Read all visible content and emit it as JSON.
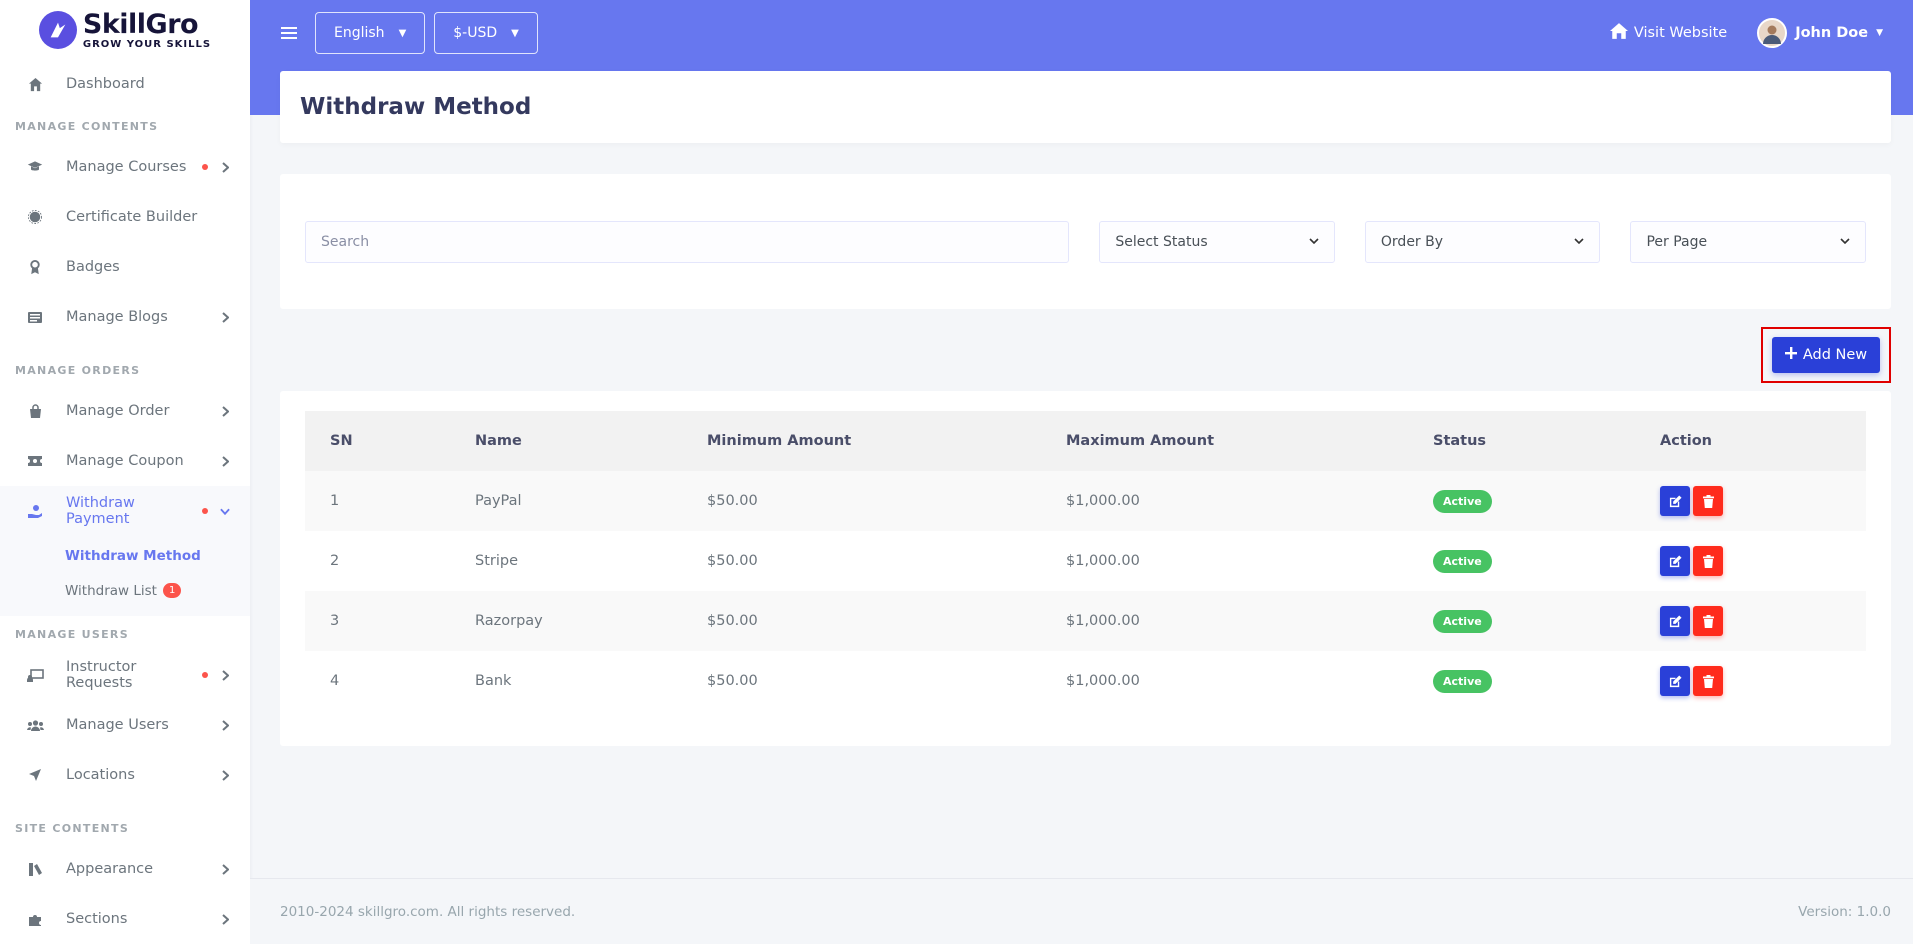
{
  "brand": {
    "name": "SkillGro",
    "tagline": "GROW YOUR SKILLS"
  },
  "sidebar": {
    "dashboard": "Dashboard",
    "headers": [
      "MANAGE CONTENTS",
      "MANAGE ORDERS",
      "MANAGE USERS",
      "SITE CONTENTS"
    ],
    "items": {
      "manage_courses": "Manage Courses",
      "certificate_builder": "Certificate Builder",
      "badges": "Badges",
      "manage_blogs": "Manage Blogs",
      "manage_order": "Manage Order",
      "manage_coupon": "Manage Coupon",
      "withdraw_payment": "Withdraw Payment",
      "instructor_requests": "Instructor Requests",
      "manage_users": "Manage Users",
      "locations": "Locations",
      "appearance": "Appearance",
      "sections": "Sections"
    },
    "submenu": {
      "withdraw_method": "Withdraw Method",
      "withdraw_list": "Withdraw List",
      "withdraw_list_count": "1"
    }
  },
  "topbar": {
    "language": "English",
    "currency": "$-USD",
    "visit_website": "Visit Website",
    "user_name": "John Doe"
  },
  "page": {
    "title": "Withdraw Method"
  },
  "filters": {
    "search_placeholder": "Search",
    "status": "Select Status",
    "order_by": "Order By",
    "per_page": "Per Page"
  },
  "add_new": "Add New",
  "table": {
    "headers": [
      "SN",
      "Name",
      "Minimum Amount",
      "Maximum Amount",
      "Status",
      "Action"
    ],
    "rows": [
      {
        "sn": "1",
        "name": "PayPal",
        "min": "$50.00",
        "max": "$1,000.00",
        "status": "Active"
      },
      {
        "sn": "2",
        "name": "Stripe",
        "min": "$50.00",
        "max": "$1,000.00",
        "status": "Active"
      },
      {
        "sn": "3",
        "name": "Razorpay",
        "min": "$50.00",
        "max": "$1,000.00",
        "status": "Active"
      },
      {
        "sn": "4",
        "name": "Bank",
        "min": "$50.00",
        "max": "$1,000.00",
        "status": "Active"
      }
    ]
  },
  "footer": {
    "copyright": "2010-2024 skillgro.com. All rights reserved.",
    "version": "Version: 1.0.0"
  },
  "colors": {
    "primary": "#6777ef",
    "button_blue": "#2a40d8",
    "danger": "#ff2b1c",
    "success": "#47c363",
    "highlight_border": "#e00000"
  }
}
